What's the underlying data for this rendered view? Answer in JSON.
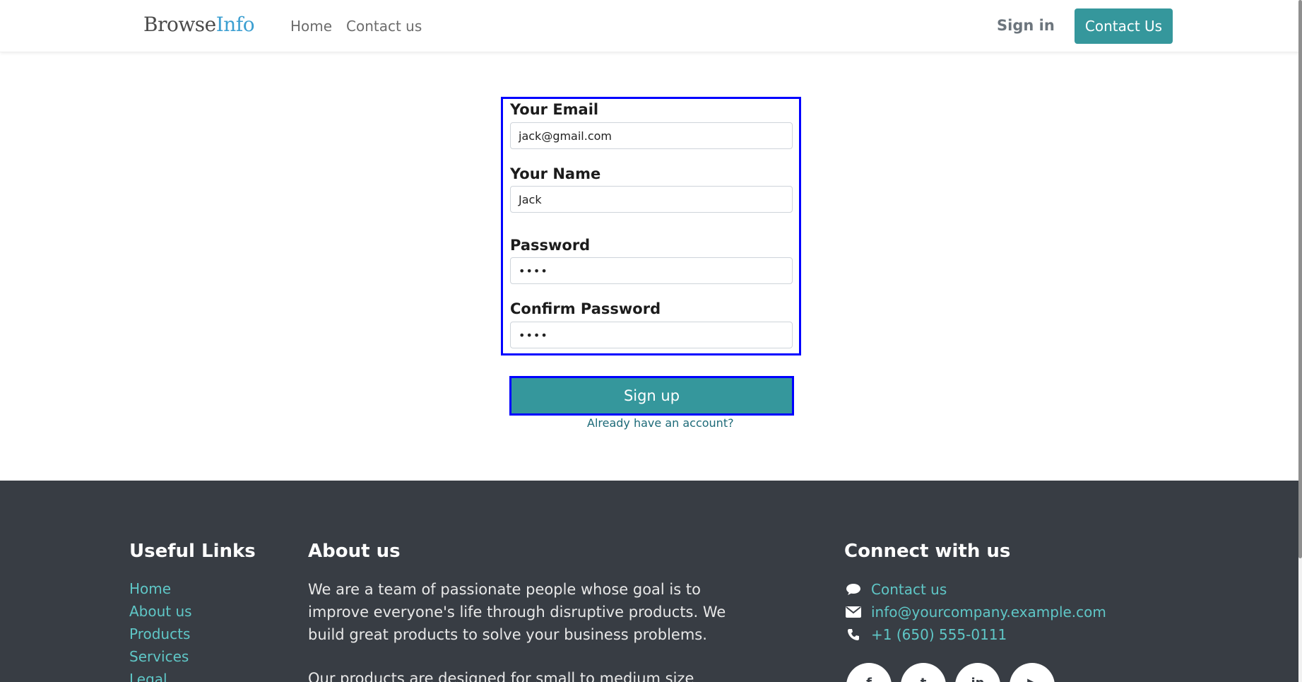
{
  "header": {
    "logo_part1": "Browse",
    "logo_part2": "Info",
    "nav": [
      "Home",
      "Contact us"
    ],
    "sign_in": "Sign in",
    "contact_button": "Contact Us"
  },
  "form": {
    "email_label": "Your Email",
    "email_value": "jack@gmail.com",
    "name_label": "Your Name",
    "name_value": "Jack",
    "password_label": "Password",
    "password_value": "••••",
    "confirm_label": "Confirm Password",
    "confirm_value": "••••",
    "signup_button": "Sign up",
    "already_link": "Already have an account?"
  },
  "footer": {
    "useful_links_title": "Useful Links",
    "useful_links": [
      "Home",
      "About us",
      "Products",
      "Services",
      "Legal"
    ],
    "about_title": "About us",
    "about_p1": "We are a team of passionate people whose goal is to improve everyone's life through disruptive products. We build great products to solve your business problems.",
    "about_p2": "Our products are designed for small to medium size",
    "connect_title": "Connect with us",
    "contact_link": "Contact us",
    "email": "info@yourcompany.example.com",
    "phone": "+1 (650) 555-0111",
    "social_icons": [
      "facebook-icon",
      "twitter-icon",
      "linkedin-icon",
      "youtube-icon"
    ]
  },
  "colors": {
    "accent": "#35979c",
    "highlight_border": "#0000ff",
    "footer_bg": "#383d44",
    "footer_link": "#5fc7c7"
  }
}
